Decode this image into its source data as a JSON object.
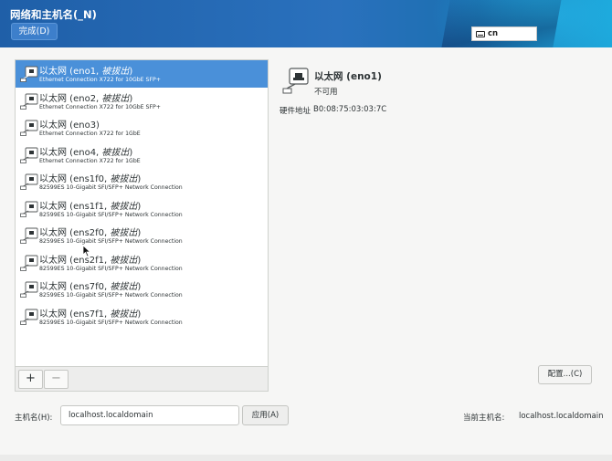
{
  "window": {
    "title": "网络和主机名(_N)",
    "done_button": "完成(D)",
    "keyboard_layout": "cn"
  },
  "devices": [
    {
      "name": "以太网 (eno1, ",
      "state": "被拔出",
      "suffix": ")",
      "desc": "Ethernet Connection X722 for 10GbE SFP+",
      "selected": true
    },
    {
      "name": "以太网 (eno2, ",
      "state": "被拔出",
      "suffix": ")",
      "desc": "Ethernet Connection X722 for 10GbE SFP+",
      "selected": false
    },
    {
      "name": "以太网 (eno3)",
      "state": "",
      "suffix": "",
      "desc": "Ethernet Connection X722 for 1GbE",
      "selected": false
    },
    {
      "name": "以太网 (eno4, ",
      "state": "被拔出",
      "suffix": ")",
      "desc": "Ethernet Connection X722 for 1GbE",
      "selected": false
    },
    {
      "name": "以太网 (ens1f0, ",
      "state": "被拔出",
      "suffix": ")",
      "desc": "82599ES 10-Gigabit SFI/SFP+ Network Connection",
      "selected": false
    },
    {
      "name": "以太网 (ens1f1, ",
      "state": "被拔出",
      "suffix": ")",
      "desc": "82599ES 10-Gigabit SFI/SFP+ Network Connection",
      "selected": false
    },
    {
      "name": "以太网 (ens2f0, ",
      "state": "被拔出",
      "suffix": ")",
      "desc": "82599ES 10-Gigabit SFI/SFP+ Network Connection",
      "selected": false
    },
    {
      "name": "以太网 (ens2f1, ",
      "state": "被拔出",
      "suffix": ")",
      "desc": "82599ES 10-Gigabit SFI/SFP+ Network Connection",
      "selected": false
    },
    {
      "name": "以太网 (ens7f0, ",
      "state": "被拔出",
      "suffix": ")",
      "desc": "82599ES 10-Gigabit SFI/SFP+ Network Connection",
      "selected": false
    },
    {
      "name": "以太网 (ens7f1, ",
      "state": "被拔出",
      "suffix": ")",
      "desc": "82599ES 10-Gigabit SFI/SFP+ Network Connection",
      "selected": false
    }
  ],
  "list_toolbar": {
    "add_label": "+",
    "remove_label": "−"
  },
  "detail": {
    "name": "以太网 (eno1)",
    "status": "不可用",
    "hw_address_label": "硬件地址",
    "hw_address_value": "B0:08:75:03:03:7C",
    "config_button": "配置...(C)"
  },
  "hostname": {
    "label": "主机名(H):",
    "value": "localhost.localdomain",
    "apply_button": "应用(A)",
    "current_label": "当前主机名:",
    "current_value": "localhost.localdomain"
  },
  "colors": {
    "selection": "#4a90d9",
    "header": "#2a71bd"
  }
}
